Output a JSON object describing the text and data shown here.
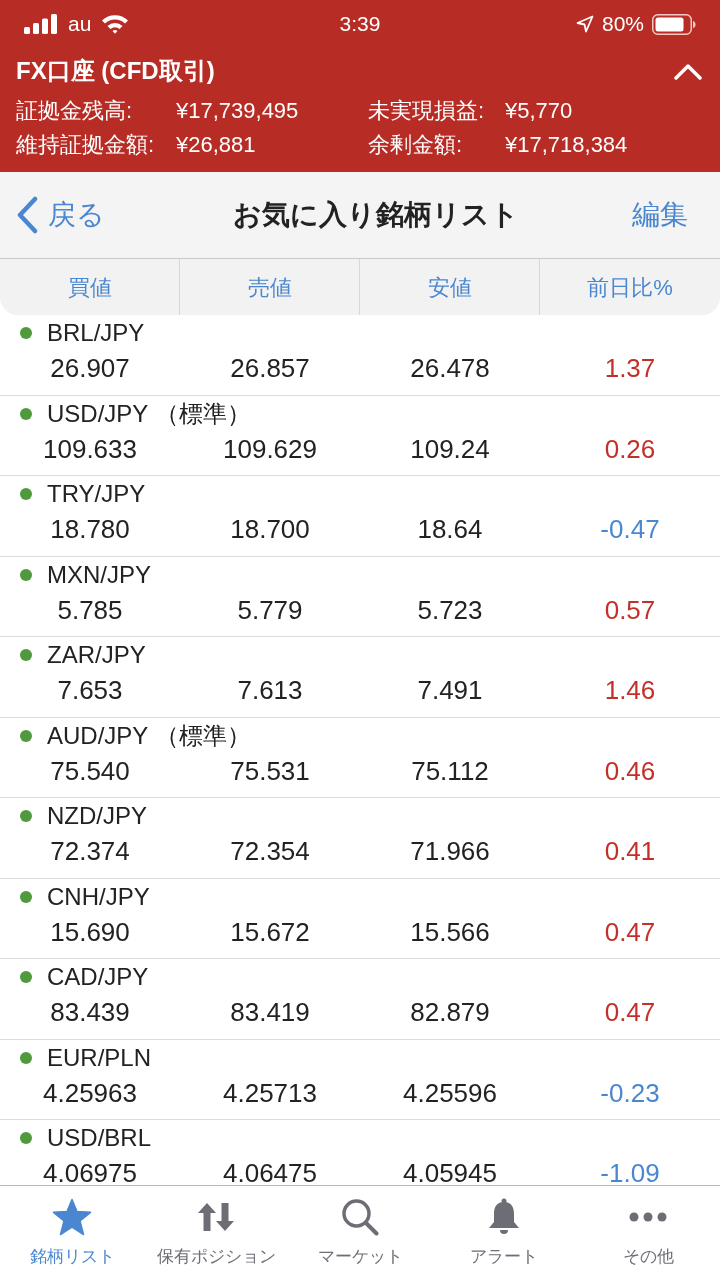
{
  "status_bar": {
    "carrier": "au",
    "time": "3:39",
    "battery": "80%"
  },
  "account": {
    "title": "FX口座 (CFD取引)",
    "expanded": true,
    "fields": [
      {
        "label": "証拠金残高:",
        "value": "¥17,739,495"
      },
      {
        "label": "未実現損益:",
        "value": "¥5,770"
      },
      {
        "label": "維持証拠金額:",
        "value": "¥26,881"
      },
      {
        "label": "余剰金額:",
        "value": "¥17,718,384"
      }
    ]
  },
  "nav_bar": {
    "back": "戻る",
    "title": "お気に入り銘柄リスト",
    "action": "編集"
  },
  "table": {
    "columns": [
      "買値",
      "売値",
      "安値",
      "前日比%"
    ],
    "rows": [
      {
        "name": "BRL/JPY",
        "market_open": true,
        "buy": "26.907",
        "sell": "26.857",
        "low": "26.478",
        "change": "1.37",
        "color": "#c3302a"
      },
      {
        "name": "USD/JPY （標準）",
        "market_open": true,
        "buy": "109.633",
        "sell": "109.629",
        "low": "109.24",
        "change": "0.26",
        "color": "#c3302a"
      },
      {
        "name": "TRY/JPY",
        "market_open": true,
        "buy": "18.780",
        "sell": "18.700",
        "low": "18.64",
        "change": "-0.47",
        "color": "#4a87d0"
      },
      {
        "name": "MXN/JPY",
        "market_open": true,
        "buy": "5.785",
        "sell": "5.779",
        "low": "5.723",
        "change": "0.57",
        "color": "#c3302a"
      },
      {
        "name": "ZAR/JPY",
        "market_open": true,
        "buy": "7.653",
        "sell": "7.613",
        "low": "7.491",
        "change": "1.46",
        "color": "#c3302a"
      },
      {
        "name": "AUD/JPY （標準）",
        "market_open": true,
        "buy": "75.540",
        "sell": "75.531",
        "low": "75.112",
        "change": "0.46",
        "color": "#c3302a"
      },
      {
        "name": "NZD/JPY",
        "market_open": true,
        "buy": "72.374",
        "sell": "72.354",
        "low": "71.966",
        "change": "0.41",
        "color": "#c3302a"
      },
      {
        "name": "CNH/JPY",
        "market_open": true,
        "buy": "15.690",
        "sell": "15.672",
        "low": "15.566",
        "change": "0.47",
        "color": "#c3302a"
      },
      {
        "name": "CAD/JPY",
        "market_open": true,
        "buy": "83.439",
        "sell": "83.419",
        "low": "82.879",
        "change": "0.47",
        "color": "#c3302a"
      },
      {
        "name": "EUR/PLN",
        "market_open": true,
        "buy": "4.25963",
        "sell": "4.25713",
        "low": "4.25596",
        "change": "-0.23",
        "color": "#4a87d0"
      },
      {
        "name": "USD/BRL",
        "market_open": true,
        "buy": "4.06975",
        "sell": "4.06475",
        "low": "4.05945",
        "change": "-1.09",
        "color": "#4a87d0"
      }
    ]
  },
  "tab_bar": {
    "items": [
      {
        "kind": "star",
        "label": "銘柄リスト",
        "selected": true
      },
      {
        "kind": "arrows",
        "label": "保有ポジション",
        "selected": false
      },
      {
        "kind": "search",
        "label": "マーケット",
        "selected": false
      },
      {
        "kind": "bell",
        "label": "アラート",
        "selected": false
      },
      {
        "kind": "more",
        "label": "その他",
        "selected": false
      }
    ]
  }
}
